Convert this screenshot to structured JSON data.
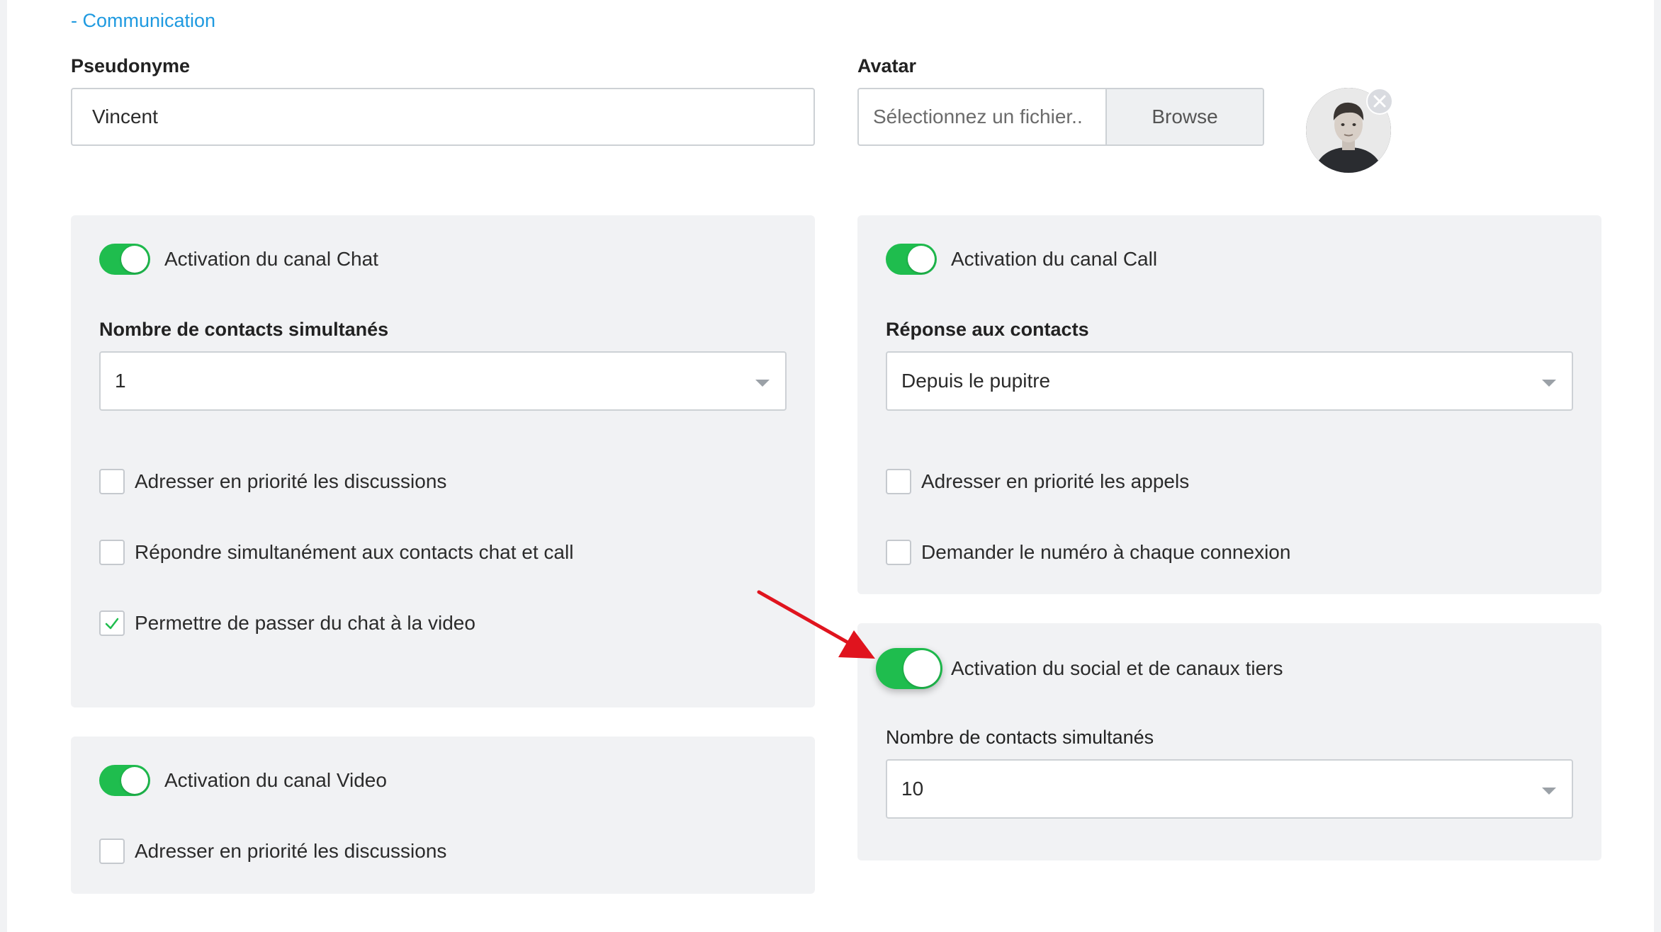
{
  "section": {
    "title": "- Communication"
  },
  "profile": {
    "pseudonyme_label": "Pseudonyme",
    "pseudonyme_value": "Vincent",
    "avatar_label": "Avatar",
    "file_placeholder": "Sélectionnez un fichier..",
    "browse_label": "Browse"
  },
  "chat_panel": {
    "toggle_label": "Activation du canal Chat",
    "toggle_on": true,
    "contacts_label": "Nombre de contacts simultanés",
    "contacts_value": "1",
    "checkboxes": [
      {
        "label": "Adresser en priorité les discussions",
        "checked": false
      },
      {
        "label": "Répondre simultanément aux contacts chat et call",
        "checked": false
      },
      {
        "label": "Permettre de passer du chat à la video",
        "checked": true
      }
    ]
  },
  "video_panel": {
    "toggle_label": "Activation du canal Video",
    "toggle_on": true,
    "checkboxes": [
      {
        "label": "Adresser en priorité les discussions",
        "checked": false
      }
    ]
  },
  "call_panel": {
    "toggle_label": "Activation du canal Call",
    "toggle_on": true,
    "response_label": "Réponse aux contacts",
    "response_value": "Depuis le pupitre",
    "checkboxes": [
      {
        "label": "Adresser en priorité les appels",
        "checked": false
      },
      {
        "label": "Demander le numéro à chaque connexion",
        "checked": false
      }
    ]
  },
  "social_panel": {
    "toggle_label": "Activation du social et de canaux tiers",
    "toggle_on": true,
    "contacts_label": "Nombre de contacts simultanés",
    "contacts_value": "10"
  },
  "colors": {
    "toggle_on": "#1fbd4e",
    "link": "#1f9ae0",
    "panel_bg": "#f1f2f4",
    "annotation_arrow": "#e0141e"
  }
}
